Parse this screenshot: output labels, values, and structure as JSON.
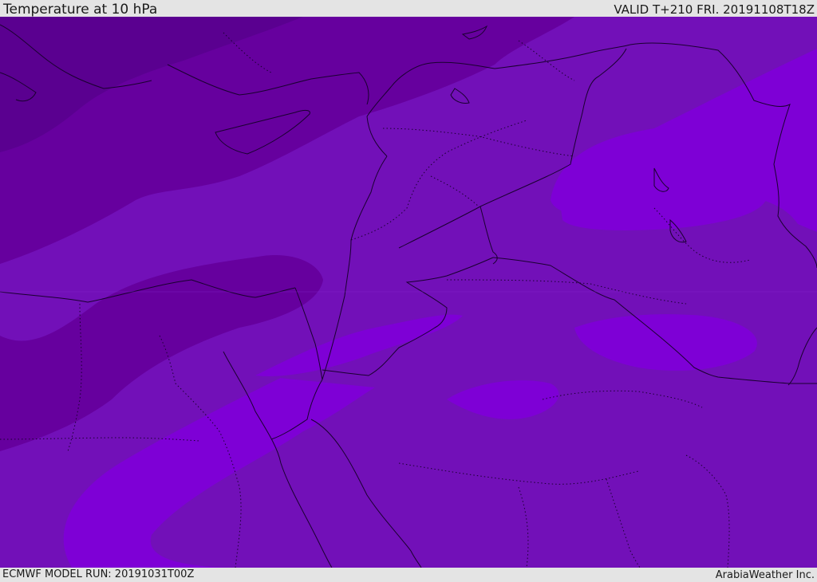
{
  "header": {
    "title": "Temperature at 10 hPa",
    "valid": "VALID T+210 FRI. 20191108T18Z"
  },
  "footer": {
    "model_run": "ECMWF MODEL RUN: 20191031T00Z",
    "credit": "ArabiaWeather Inc."
  },
  "map": {
    "field": "temperature",
    "level": "10 hPa",
    "shade_colors": {
      "darkest": "#5a0090",
      "dark": "#66009e",
      "medium": "#7210b8",
      "light": "#7e00d6",
      "coast_line": "#1a0030"
    }
  }
}
